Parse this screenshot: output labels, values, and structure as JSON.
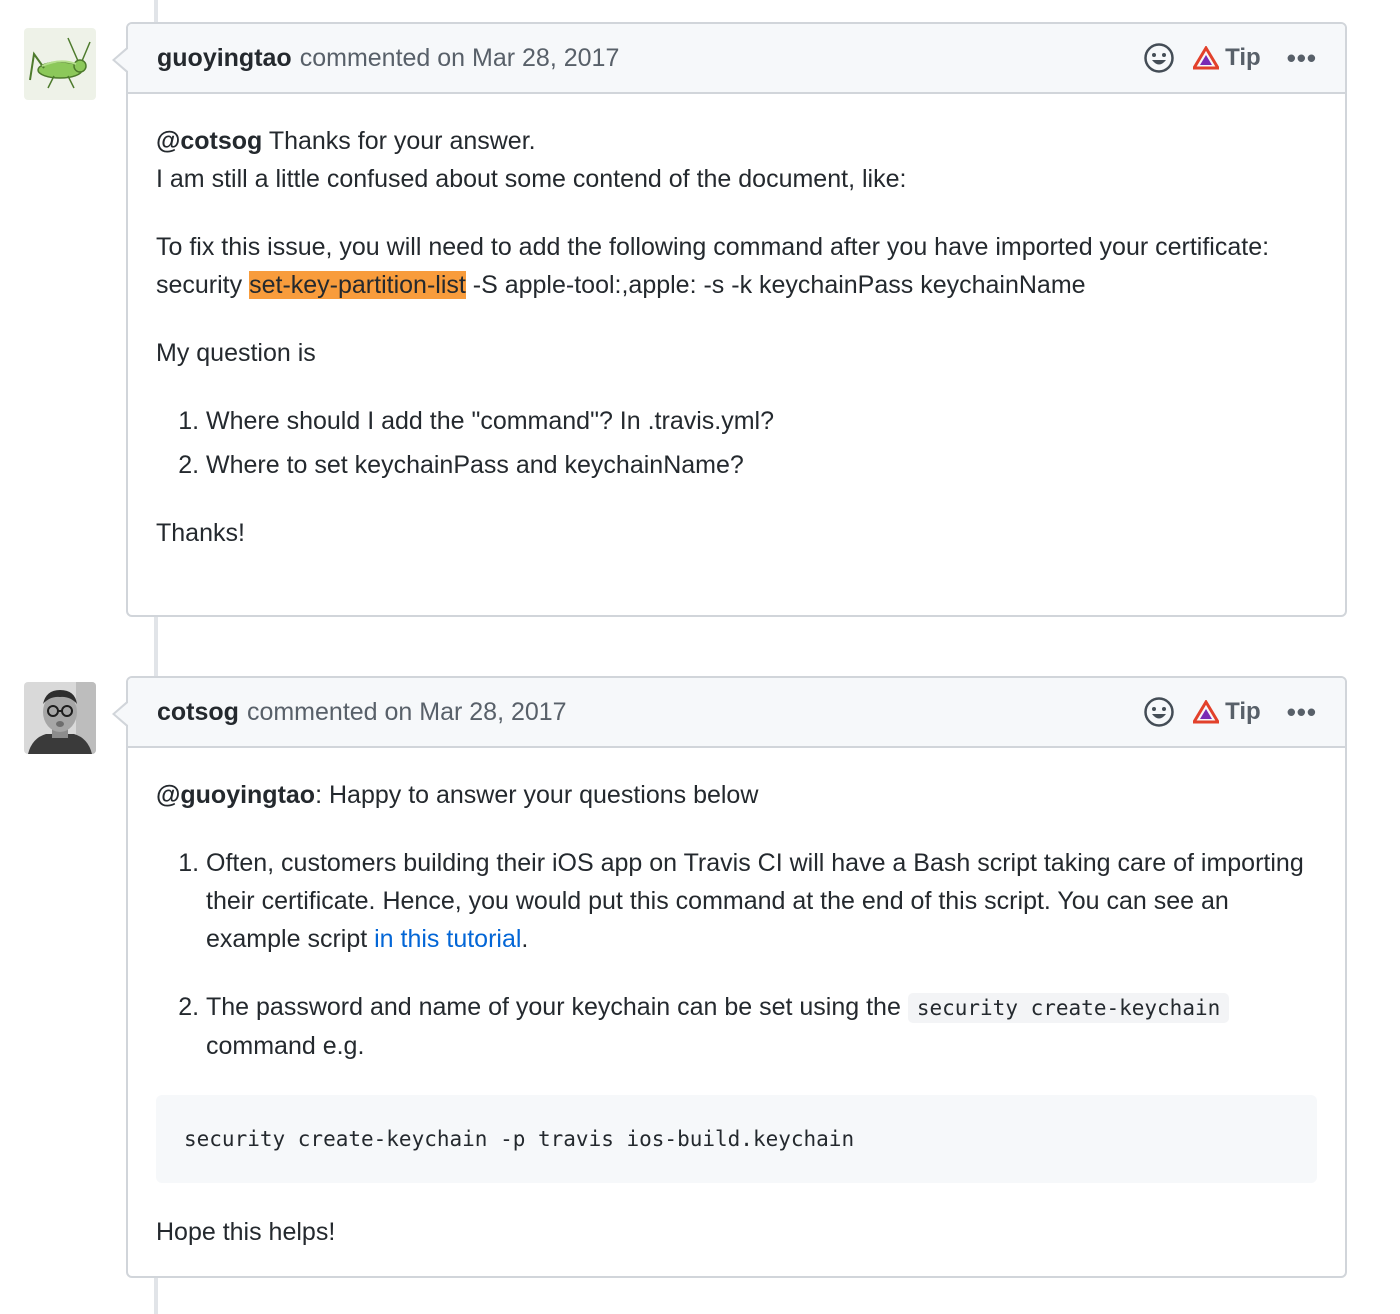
{
  "comments": [
    {
      "author": "guoyingtao",
      "meta": "commented on Mar 28, 2017",
      "tip_label": "Tip",
      "more_label": "•••",
      "body": {
        "mention": "@cotsog",
        "line1_rest": " Thanks for your answer.",
        "line2": "I am still a little confused about some contend of the document, like:",
        "para2_line1": "To fix this issue, you will need to add the following command after you have imported your certificate:",
        "cmd_prefix": "security ",
        "cmd_highlight": "set-key-partition-list",
        "cmd_rest": " -S apple-tool:,apple: -s -k keychainPass keychainName",
        "question_intro": "My question is",
        "questions": [
          "Where should I add the \"command\"? In .travis.yml?",
          "Where to set keychainPass and keychainName?"
        ],
        "closing": "Thanks!"
      }
    },
    {
      "author": "cotsog",
      "meta": "commented on Mar 28, 2017",
      "tip_label": "Tip",
      "more_label": "•••",
      "body": {
        "mention": "@guoyingtao",
        "intro_rest": ": Happy to answer your questions below",
        "answer1_text": "Often, customers building their iOS app on Travis CI will have a Bash script taking care of importing their certificate. Hence, you would put this command at the end of this script. You can see an example script ",
        "answer1_link": "in this tutorial",
        "answer1_end": ".",
        "answer2_text": "The password and name of your keychain can be set using the ",
        "answer2_code": "security create-keychain",
        "answer2_end": " command e.g.",
        "code_block": "security create-keychain -p travis ios-build.keychain",
        "closing": "Hope this helps!"
      }
    }
  ]
}
